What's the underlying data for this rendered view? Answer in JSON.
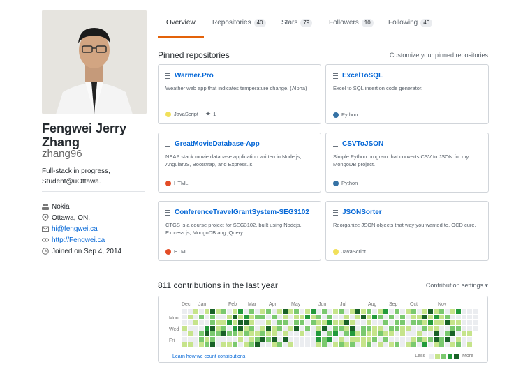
{
  "profile": {
    "full_name": "Fengwei Jerry Zhang",
    "login": "zhang96",
    "bio": "Full-stack in progress, Student@uOttawa.",
    "org": "Nokia",
    "location": "Ottawa, ON.",
    "email": "hi@fengwei.ca",
    "website": "http://Fengwei.ca",
    "joined": "Joined on Sep 4, 2014"
  },
  "tabs": [
    {
      "label": "Overview",
      "count": ""
    },
    {
      "label": "Repositories",
      "count": "40"
    },
    {
      "label": "Stars",
      "count": "79"
    },
    {
      "label": "Followers",
      "count": "10"
    },
    {
      "label": "Following",
      "count": "40"
    }
  ],
  "pinned": {
    "title": "Pinned repositories",
    "customize": "Customize your pinned repositories",
    "repos": [
      {
        "name": "Warmer.Pro",
        "desc": "Weather web app that indicates temperature change. (Alpha)",
        "lang": "JavaScript",
        "lang_color": "#f1e05a",
        "stars": "1"
      },
      {
        "name": "ExcelToSQL",
        "desc": "Excel to SQL insertion code generator.",
        "lang": "Python",
        "lang_color": "#3572A5",
        "stars": ""
      },
      {
        "name": "GreatMovieDatabase-App",
        "desc": "NEAP stack movie database application written in Node.js, AngularJS, Bootstrap, and Express.js.",
        "lang": "HTML",
        "lang_color": "#e34c26",
        "stars": ""
      },
      {
        "name": "CSVToJSON",
        "desc": "Simple Python program that converts CSV to JSON for my MongoDB project.",
        "lang": "Python",
        "lang_color": "#3572A5",
        "stars": ""
      },
      {
        "name": "ConferenceTravelGrantSystem-SEG3102",
        "desc": "CTGS is a course project for SEG3102, built using Nodejs, Express.js, MongoDB ang jQuery",
        "lang": "HTML",
        "lang_color": "#e34c26",
        "stars": ""
      },
      {
        "name": "JSONSorter",
        "desc": "Reorganize JSON objects that way you wanted to, OCD cure.",
        "lang": "JavaScript",
        "lang_color": "#f1e05a",
        "stars": ""
      }
    ]
  },
  "contributions": {
    "title": "811 contributions in the last year",
    "settings": "Contribution settings ▾",
    "months": [
      "Dec",
      "Jan",
      "Feb",
      "Mar",
      "Apr",
      "May",
      "Jun",
      "Jul",
      "Aug",
      "Sep",
      "Oct",
      "Nov"
    ],
    "days": [
      "Mon",
      "Wed",
      "Fri"
    ],
    "learn": "Learn how we count contributions.",
    "legend_less": "Less",
    "legend_more": "More",
    "colors": [
      "#ebedf0",
      "#c6e48b",
      "#7bc96f",
      "#239a3b",
      "#196127"
    ]
  }
}
